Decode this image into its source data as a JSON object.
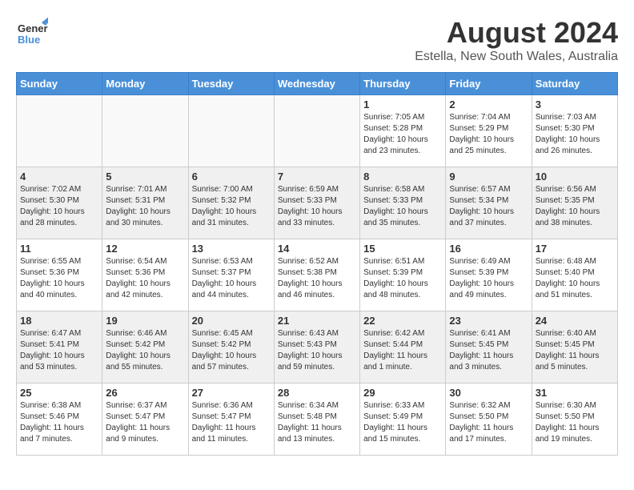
{
  "header": {
    "logo_general": "General",
    "logo_blue": "Blue",
    "title": "August 2024",
    "subtitle": "Estella, New South Wales, Australia"
  },
  "weekdays": [
    "Sunday",
    "Monday",
    "Tuesday",
    "Wednesday",
    "Thursday",
    "Friday",
    "Saturday"
  ],
  "weeks": [
    [
      {
        "day": "",
        "info": "",
        "empty": true
      },
      {
        "day": "",
        "info": "",
        "empty": true
      },
      {
        "day": "",
        "info": "",
        "empty": true
      },
      {
        "day": "",
        "info": "",
        "empty": true
      },
      {
        "day": "1",
        "info": "Sunrise: 7:05 AM\nSunset: 5:28 PM\nDaylight: 10 hours\nand 23 minutes.",
        "empty": false
      },
      {
        "day": "2",
        "info": "Sunrise: 7:04 AM\nSunset: 5:29 PM\nDaylight: 10 hours\nand 25 minutes.",
        "empty": false
      },
      {
        "day": "3",
        "info": "Sunrise: 7:03 AM\nSunset: 5:30 PM\nDaylight: 10 hours\nand 26 minutes.",
        "empty": false
      }
    ],
    [
      {
        "day": "4",
        "info": "Sunrise: 7:02 AM\nSunset: 5:30 PM\nDaylight: 10 hours\nand 28 minutes.",
        "empty": false
      },
      {
        "day": "5",
        "info": "Sunrise: 7:01 AM\nSunset: 5:31 PM\nDaylight: 10 hours\nand 30 minutes.",
        "empty": false
      },
      {
        "day": "6",
        "info": "Sunrise: 7:00 AM\nSunset: 5:32 PM\nDaylight: 10 hours\nand 31 minutes.",
        "empty": false
      },
      {
        "day": "7",
        "info": "Sunrise: 6:59 AM\nSunset: 5:33 PM\nDaylight: 10 hours\nand 33 minutes.",
        "empty": false
      },
      {
        "day": "8",
        "info": "Sunrise: 6:58 AM\nSunset: 5:33 PM\nDaylight: 10 hours\nand 35 minutes.",
        "empty": false
      },
      {
        "day": "9",
        "info": "Sunrise: 6:57 AM\nSunset: 5:34 PM\nDaylight: 10 hours\nand 37 minutes.",
        "empty": false
      },
      {
        "day": "10",
        "info": "Sunrise: 6:56 AM\nSunset: 5:35 PM\nDaylight: 10 hours\nand 38 minutes.",
        "empty": false
      }
    ],
    [
      {
        "day": "11",
        "info": "Sunrise: 6:55 AM\nSunset: 5:36 PM\nDaylight: 10 hours\nand 40 minutes.",
        "empty": false
      },
      {
        "day": "12",
        "info": "Sunrise: 6:54 AM\nSunset: 5:36 PM\nDaylight: 10 hours\nand 42 minutes.",
        "empty": false
      },
      {
        "day": "13",
        "info": "Sunrise: 6:53 AM\nSunset: 5:37 PM\nDaylight: 10 hours\nand 44 minutes.",
        "empty": false
      },
      {
        "day": "14",
        "info": "Sunrise: 6:52 AM\nSunset: 5:38 PM\nDaylight: 10 hours\nand 46 minutes.",
        "empty": false
      },
      {
        "day": "15",
        "info": "Sunrise: 6:51 AM\nSunset: 5:39 PM\nDaylight: 10 hours\nand 48 minutes.",
        "empty": false
      },
      {
        "day": "16",
        "info": "Sunrise: 6:49 AM\nSunset: 5:39 PM\nDaylight: 10 hours\nand 49 minutes.",
        "empty": false
      },
      {
        "day": "17",
        "info": "Sunrise: 6:48 AM\nSunset: 5:40 PM\nDaylight: 10 hours\nand 51 minutes.",
        "empty": false
      }
    ],
    [
      {
        "day": "18",
        "info": "Sunrise: 6:47 AM\nSunset: 5:41 PM\nDaylight: 10 hours\nand 53 minutes.",
        "empty": false
      },
      {
        "day": "19",
        "info": "Sunrise: 6:46 AM\nSunset: 5:42 PM\nDaylight: 10 hours\nand 55 minutes.",
        "empty": false
      },
      {
        "day": "20",
        "info": "Sunrise: 6:45 AM\nSunset: 5:42 PM\nDaylight: 10 hours\nand 57 minutes.",
        "empty": false
      },
      {
        "day": "21",
        "info": "Sunrise: 6:43 AM\nSunset: 5:43 PM\nDaylight: 10 hours\nand 59 minutes.",
        "empty": false
      },
      {
        "day": "22",
        "info": "Sunrise: 6:42 AM\nSunset: 5:44 PM\nDaylight: 11 hours\nand 1 minute.",
        "empty": false
      },
      {
        "day": "23",
        "info": "Sunrise: 6:41 AM\nSunset: 5:45 PM\nDaylight: 11 hours\nand 3 minutes.",
        "empty": false
      },
      {
        "day": "24",
        "info": "Sunrise: 6:40 AM\nSunset: 5:45 PM\nDaylight: 11 hours\nand 5 minutes.",
        "empty": false
      }
    ],
    [
      {
        "day": "25",
        "info": "Sunrise: 6:38 AM\nSunset: 5:46 PM\nDaylight: 11 hours\nand 7 minutes.",
        "empty": false
      },
      {
        "day": "26",
        "info": "Sunrise: 6:37 AM\nSunset: 5:47 PM\nDaylight: 11 hours\nand 9 minutes.",
        "empty": false
      },
      {
        "day": "27",
        "info": "Sunrise: 6:36 AM\nSunset: 5:47 PM\nDaylight: 11 hours\nand 11 minutes.",
        "empty": false
      },
      {
        "day": "28",
        "info": "Sunrise: 6:34 AM\nSunset: 5:48 PM\nDaylight: 11 hours\nand 13 minutes.",
        "empty": false
      },
      {
        "day": "29",
        "info": "Sunrise: 6:33 AM\nSunset: 5:49 PM\nDaylight: 11 hours\nand 15 minutes.",
        "empty": false
      },
      {
        "day": "30",
        "info": "Sunrise: 6:32 AM\nSunset: 5:50 PM\nDaylight: 11 hours\nand 17 minutes.",
        "empty": false
      },
      {
        "day": "31",
        "info": "Sunrise: 6:30 AM\nSunset: 5:50 PM\nDaylight: 11 hours\nand 19 minutes.",
        "empty": false
      }
    ]
  ]
}
